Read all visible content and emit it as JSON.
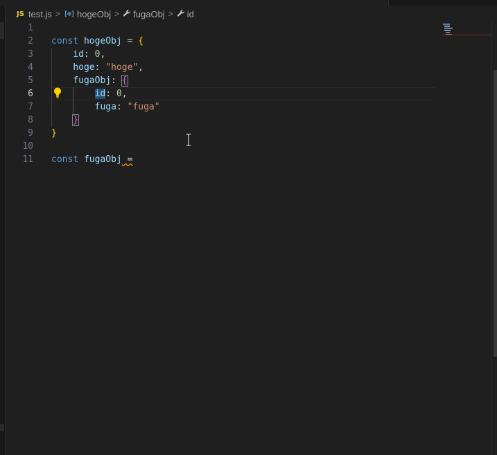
{
  "breadcrumb": {
    "file_badge": "JS",
    "file": "test.js",
    "obj_icon": "[⊚]",
    "item1": "hogeObj",
    "item2": "fugaObj",
    "item3": "id",
    "separator": ">"
  },
  "editor": {
    "line_numbers": [
      "1",
      "2",
      "3",
      "4",
      "5",
      "6",
      "7",
      "8",
      "9",
      "10",
      "11"
    ],
    "active_line": "6",
    "tokens": {
      "l2": {
        "kw": "const",
        "var": "hogeObj",
        "op": " = ",
        "brace": "{"
      },
      "l3": {
        "key": "id",
        "colon": ": ",
        "num": "0",
        "comma": ","
      },
      "l4": {
        "key": "hoge",
        "colon": ": ",
        "str": "\"hoge\"",
        "comma": ","
      },
      "l5": {
        "key": "fugaObj",
        "colon": ": ",
        "brace": "{"
      },
      "l6": {
        "key": "id",
        "colon": ": ",
        "num": "0",
        "comma": ","
      },
      "l7": {
        "key": "fuga",
        "colon": ": ",
        "str": "\"fuga\""
      },
      "l8": {
        "brace": "}"
      },
      "l9": {
        "brace": "}"
      },
      "l11": {
        "kw": "const",
        "var": "fugaObj",
        "op": " ="
      }
    }
  },
  "colors": {
    "keyword": "#569cd6",
    "variable": "#9cdcfe",
    "number": "#b5cea8",
    "string": "#ce9178",
    "brace_level1": "#ffd700",
    "brace_level2": "#da70d6",
    "lightbulb": "#ffcc00"
  },
  "icons": {
    "js_file": "js-file-icon",
    "object": "object-icon",
    "property": "wrench-icon",
    "lightbulb": "lightbulb-icon",
    "text_cursor": "text-cursor-icon"
  }
}
